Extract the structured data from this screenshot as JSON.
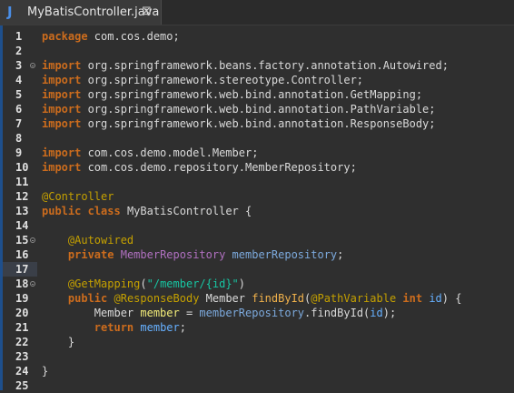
{
  "tab": {
    "icon": "java-file-icon",
    "title": "MyBatisController.java",
    "close_label": "⊠"
  },
  "colors": {
    "background": "#2f2f2f",
    "keyword": "#cc6c1d",
    "annotation": "#c4a000",
    "type": "#b070c0",
    "field": "#7ca9dc",
    "string": "#17c6a3",
    "method": "#f0b14b",
    "variable": "#f3ec79",
    "parameter": "#66b0ff"
  },
  "lines": [
    {
      "n": "1",
      "fold": false,
      "hl": false,
      "segs": [
        {
          "t": "package",
          "c": "kw"
        },
        {
          "t": " com.cos.demo;",
          "c": "txt"
        }
      ]
    },
    {
      "n": "2",
      "fold": false,
      "hl": false,
      "segs": []
    },
    {
      "n": "3",
      "fold": true,
      "hl": false,
      "segs": [
        {
          "t": "import",
          "c": "kw"
        },
        {
          "t": " org.springframework.beans.factory.annotation.Autowired;",
          "c": "txt"
        }
      ]
    },
    {
      "n": "4",
      "fold": false,
      "hl": false,
      "segs": [
        {
          "t": "import",
          "c": "kw"
        },
        {
          "t": " org.springframework.stereotype.Controller;",
          "c": "txt"
        }
      ]
    },
    {
      "n": "5",
      "fold": false,
      "hl": false,
      "segs": [
        {
          "t": "import",
          "c": "kw"
        },
        {
          "t": " org.springframework.web.bind.annotation.GetMapping;",
          "c": "txt"
        }
      ]
    },
    {
      "n": "6",
      "fold": false,
      "hl": false,
      "segs": [
        {
          "t": "import",
          "c": "kw"
        },
        {
          "t": " org.springframework.web.bind.annotation.PathVariable;",
          "c": "txt"
        }
      ]
    },
    {
      "n": "7",
      "fold": false,
      "hl": false,
      "segs": [
        {
          "t": "import",
          "c": "kw"
        },
        {
          "t": " org.springframework.web.bind.annotation.ResponseBody;",
          "c": "txt"
        }
      ]
    },
    {
      "n": "8",
      "fold": false,
      "hl": false,
      "segs": []
    },
    {
      "n": "9",
      "fold": false,
      "hl": false,
      "segs": [
        {
          "t": "import",
          "c": "kw"
        },
        {
          "t": " com.cos.demo.model.Member;",
          "c": "txt"
        }
      ]
    },
    {
      "n": "10",
      "fold": false,
      "hl": false,
      "segs": [
        {
          "t": "import",
          "c": "kw"
        },
        {
          "t": " com.cos.demo.repository.MemberRepository;",
          "c": "txt"
        }
      ]
    },
    {
      "n": "11",
      "fold": false,
      "hl": false,
      "segs": []
    },
    {
      "n": "12",
      "fold": false,
      "hl": false,
      "segs": [
        {
          "t": "@Controller",
          "c": "ann"
        }
      ]
    },
    {
      "n": "13",
      "fold": false,
      "hl": false,
      "segs": [
        {
          "t": "public",
          "c": "kw"
        },
        {
          "t": " ",
          "c": "txt"
        },
        {
          "t": "class",
          "c": "kw"
        },
        {
          "t": " MyBatisController {",
          "c": "txt"
        }
      ]
    },
    {
      "n": "14",
      "fold": false,
      "hl": false,
      "segs": []
    },
    {
      "n": "15",
      "fold": true,
      "hl": false,
      "segs": [
        {
          "t": "    ",
          "c": "txt"
        },
        {
          "t": "@Autowired",
          "c": "ann"
        }
      ]
    },
    {
      "n": "16",
      "fold": false,
      "hl": false,
      "segs": [
        {
          "t": "    ",
          "c": "txt"
        },
        {
          "t": "private",
          "c": "kw"
        },
        {
          "t": " ",
          "c": "txt"
        },
        {
          "t": "MemberRepository",
          "c": "type"
        },
        {
          "t": " ",
          "c": "txt"
        },
        {
          "t": "memberRepository",
          "c": "field"
        },
        {
          "t": ";",
          "c": "txt"
        }
      ]
    },
    {
      "n": "17",
      "fold": false,
      "hl": true,
      "segs": []
    },
    {
      "n": "18",
      "fold": true,
      "hl": false,
      "segs": [
        {
          "t": "    ",
          "c": "txt"
        },
        {
          "t": "@GetMapping",
          "c": "ann"
        },
        {
          "t": "(",
          "c": "txt"
        },
        {
          "t": "\"/member/{id}\"",
          "c": "str"
        },
        {
          "t": ")",
          "c": "txt"
        }
      ]
    },
    {
      "n": "19",
      "fold": false,
      "hl": false,
      "segs": [
        {
          "t": "    ",
          "c": "txt"
        },
        {
          "t": "public",
          "c": "kw"
        },
        {
          "t": " ",
          "c": "txt"
        },
        {
          "t": "@ResponseBody",
          "c": "ann"
        },
        {
          "t": " Member ",
          "c": "txt"
        },
        {
          "t": "findById",
          "c": "method"
        },
        {
          "t": "(",
          "c": "txt"
        },
        {
          "t": "@PathVariable",
          "c": "ann"
        },
        {
          "t": " ",
          "c": "txt"
        },
        {
          "t": "int",
          "c": "kw"
        },
        {
          "t": " ",
          "c": "txt"
        },
        {
          "t": "id",
          "c": "param"
        },
        {
          "t": ") {",
          "c": "txt"
        }
      ]
    },
    {
      "n": "20",
      "fold": false,
      "hl": false,
      "segs": [
        {
          "t": "        Member ",
          "c": "txt"
        },
        {
          "t": "member",
          "c": "var"
        },
        {
          "t": " = ",
          "c": "txt"
        },
        {
          "t": "memberRepository",
          "c": "field"
        },
        {
          "t": ".findById(",
          "c": "txt"
        },
        {
          "t": "id",
          "c": "param"
        },
        {
          "t": ");",
          "c": "txt"
        }
      ]
    },
    {
      "n": "21",
      "fold": false,
      "hl": false,
      "segs": [
        {
          "t": "        ",
          "c": "txt"
        },
        {
          "t": "return",
          "c": "kw"
        },
        {
          "t": " ",
          "c": "txt"
        },
        {
          "t": "member",
          "c": "param"
        },
        {
          "t": ";",
          "c": "txt"
        }
      ]
    },
    {
      "n": "22",
      "fold": false,
      "hl": false,
      "segs": [
        {
          "t": "    }",
          "c": "txt"
        }
      ]
    },
    {
      "n": "23",
      "fold": false,
      "hl": false,
      "segs": []
    },
    {
      "n": "24",
      "fold": false,
      "hl": false,
      "segs": [
        {
          "t": "}",
          "c": "txt"
        }
      ]
    },
    {
      "n": "25",
      "fold": false,
      "hl": false,
      "segs": []
    }
  ]
}
